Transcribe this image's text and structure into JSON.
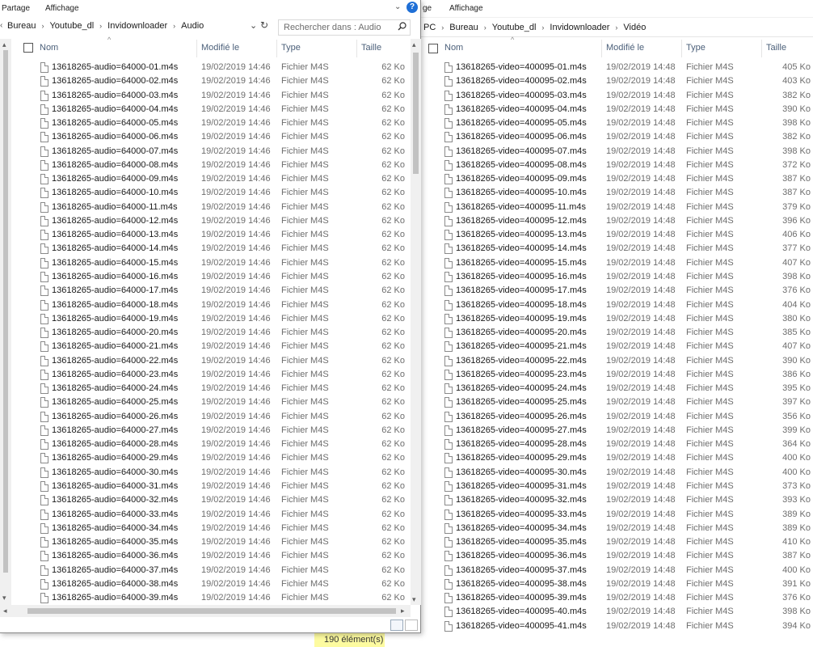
{
  "left_window": {
    "ribbon": {
      "share": "Partage",
      "view": "Affichage"
    },
    "breadcrumb": [
      "Bureau",
      "Youtube_dl",
      "Invidownloader",
      "Audio"
    ],
    "search_placeholder": "Rechercher dans : Audio",
    "columns": {
      "name": "Nom",
      "modified": "Modifié le",
      "type": "Type",
      "size": "Taille"
    },
    "files": [
      {
        "name": "13618265-audio=64000-01.m4s",
        "date": "19/02/2019 14:46",
        "type": "Fichier M4S",
        "size": "62 Ko"
      },
      {
        "name": "13618265-audio=64000-02.m4s",
        "date": "19/02/2019 14:46",
        "type": "Fichier M4S",
        "size": "62 Ko"
      },
      {
        "name": "13618265-audio=64000-03.m4s",
        "date": "19/02/2019 14:46",
        "type": "Fichier M4S",
        "size": "62 Ko"
      },
      {
        "name": "13618265-audio=64000-04.m4s",
        "date": "19/02/2019 14:46",
        "type": "Fichier M4S",
        "size": "62 Ko"
      },
      {
        "name": "13618265-audio=64000-05.m4s",
        "date": "19/02/2019 14:46",
        "type": "Fichier M4S",
        "size": "62 Ko"
      },
      {
        "name": "13618265-audio=64000-06.m4s",
        "date": "19/02/2019 14:46",
        "type": "Fichier M4S",
        "size": "62 Ko"
      },
      {
        "name": "13618265-audio=64000-07.m4s",
        "date": "19/02/2019 14:46",
        "type": "Fichier M4S",
        "size": "62 Ko"
      },
      {
        "name": "13618265-audio=64000-08.m4s",
        "date": "19/02/2019 14:46",
        "type": "Fichier M4S",
        "size": "62 Ko"
      },
      {
        "name": "13618265-audio=64000-09.m4s",
        "date": "19/02/2019 14:46",
        "type": "Fichier M4S",
        "size": "62 Ko"
      },
      {
        "name": "13618265-audio=64000-10.m4s",
        "date": "19/02/2019 14:46",
        "type": "Fichier M4S",
        "size": "62 Ko"
      },
      {
        "name": "13618265-audio=64000-11.m4s",
        "date": "19/02/2019 14:46",
        "type": "Fichier M4S",
        "size": "62 Ko"
      },
      {
        "name": "13618265-audio=64000-12.m4s",
        "date": "19/02/2019 14:46",
        "type": "Fichier M4S",
        "size": "62 Ko"
      },
      {
        "name": "13618265-audio=64000-13.m4s",
        "date": "19/02/2019 14:46",
        "type": "Fichier M4S",
        "size": "62 Ko"
      },
      {
        "name": "13618265-audio=64000-14.m4s",
        "date": "19/02/2019 14:46",
        "type": "Fichier M4S",
        "size": "62 Ko"
      },
      {
        "name": "13618265-audio=64000-15.m4s",
        "date": "19/02/2019 14:46",
        "type": "Fichier M4S",
        "size": "62 Ko"
      },
      {
        "name": "13618265-audio=64000-16.m4s",
        "date": "19/02/2019 14:46",
        "type": "Fichier M4S",
        "size": "62 Ko"
      },
      {
        "name": "13618265-audio=64000-17.m4s",
        "date": "19/02/2019 14:46",
        "type": "Fichier M4S",
        "size": "62 Ko"
      },
      {
        "name": "13618265-audio=64000-18.m4s",
        "date": "19/02/2019 14:46",
        "type": "Fichier M4S",
        "size": "62 Ko"
      },
      {
        "name": "13618265-audio=64000-19.m4s",
        "date": "19/02/2019 14:46",
        "type": "Fichier M4S",
        "size": "62 Ko"
      },
      {
        "name": "13618265-audio=64000-20.m4s",
        "date": "19/02/2019 14:46",
        "type": "Fichier M4S",
        "size": "62 Ko"
      },
      {
        "name": "13618265-audio=64000-21.m4s",
        "date": "19/02/2019 14:46",
        "type": "Fichier M4S",
        "size": "62 Ko"
      },
      {
        "name": "13618265-audio=64000-22.m4s",
        "date": "19/02/2019 14:46",
        "type": "Fichier M4S",
        "size": "62 Ko"
      },
      {
        "name": "13618265-audio=64000-23.m4s",
        "date": "19/02/2019 14:46",
        "type": "Fichier M4S",
        "size": "62 Ko"
      },
      {
        "name": "13618265-audio=64000-24.m4s",
        "date": "19/02/2019 14:46",
        "type": "Fichier M4S",
        "size": "62 Ko"
      },
      {
        "name": "13618265-audio=64000-25.m4s",
        "date": "19/02/2019 14:46",
        "type": "Fichier M4S",
        "size": "62 Ko"
      },
      {
        "name": "13618265-audio=64000-26.m4s",
        "date": "19/02/2019 14:46",
        "type": "Fichier M4S",
        "size": "62 Ko"
      },
      {
        "name": "13618265-audio=64000-27.m4s",
        "date": "19/02/2019 14:46",
        "type": "Fichier M4S",
        "size": "62 Ko"
      },
      {
        "name": "13618265-audio=64000-28.m4s",
        "date": "19/02/2019 14:46",
        "type": "Fichier M4S",
        "size": "62 Ko"
      },
      {
        "name": "13618265-audio=64000-29.m4s",
        "date": "19/02/2019 14:46",
        "type": "Fichier M4S",
        "size": "62 Ko"
      },
      {
        "name": "13618265-audio=64000-30.m4s",
        "date": "19/02/2019 14:46",
        "type": "Fichier M4S",
        "size": "62 Ko"
      },
      {
        "name": "13618265-audio=64000-31.m4s",
        "date": "19/02/2019 14:46",
        "type": "Fichier M4S",
        "size": "62 Ko"
      },
      {
        "name": "13618265-audio=64000-32.m4s",
        "date": "19/02/2019 14:46",
        "type": "Fichier M4S",
        "size": "62 Ko"
      },
      {
        "name": "13618265-audio=64000-33.m4s",
        "date": "19/02/2019 14:46",
        "type": "Fichier M4S",
        "size": "62 Ko"
      },
      {
        "name": "13618265-audio=64000-34.m4s",
        "date": "19/02/2019 14:46",
        "type": "Fichier M4S",
        "size": "62 Ko"
      },
      {
        "name": "13618265-audio=64000-35.m4s",
        "date": "19/02/2019 14:46",
        "type": "Fichier M4S",
        "size": "62 Ko"
      },
      {
        "name": "13618265-audio=64000-36.m4s",
        "date": "19/02/2019 14:46",
        "type": "Fichier M4S",
        "size": "62 Ko"
      },
      {
        "name": "13618265-audio=64000-37.m4s",
        "date": "19/02/2019 14:46",
        "type": "Fichier M4S",
        "size": "62 Ko"
      },
      {
        "name": "13618265-audio=64000-38.m4s",
        "date": "19/02/2019 14:46",
        "type": "Fichier M4S",
        "size": "62 Ko"
      },
      {
        "name": "13618265-audio=64000-39.m4s",
        "date": "19/02/2019 14:46",
        "type": "Fichier M4S",
        "size": "62 Ko"
      }
    ]
  },
  "right_window": {
    "ribbon": {
      "share_partial": "ge",
      "view": "Affichage"
    },
    "breadcrumb": [
      "PC",
      "Bureau",
      "Youtube_dl",
      "Invidownloader",
      "Vidéo"
    ],
    "columns": {
      "name": "Nom",
      "modified": "Modifié le",
      "type": "Type",
      "size": "Taille"
    },
    "files": [
      {
        "name": "13618265-video=400095-01.m4s",
        "date": "19/02/2019 14:48",
        "type": "Fichier M4S",
        "size": "405 Ko"
      },
      {
        "name": "13618265-video=400095-02.m4s",
        "date": "19/02/2019 14:48",
        "type": "Fichier M4S",
        "size": "403 Ko"
      },
      {
        "name": "13618265-video=400095-03.m4s",
        "date": "19/02/2019 14:48",
        "type": "Fichier M4S",
        "size": "382 Ko"
      },
      {
        "name": "13618265-video=400095-04.m4s",
        "date": "19/02/2019 14:48",
        "type": "Fichier M4S",
        "size": "390 Ko"
      },
      {
        "name": "13618265-video=400095-05.m4s",
        "date": "19/02/2019 14:48",
        "type": "Fichier M4S",
        "size": "398 Ko"
      },
      {
        "name": "13618265-video=400095-06.m4s",
        "date": "19/02/2019 14:48",
        "type": "Fichier M4S",
        "size": "382 Ko"
      },
      {
        "name": "13618265-video=400095-07.m4s",
        "date": "19/02/2019 14:48",
        "type": "Fichier M4S",
        "size": "398 Ko"
      },
      {
        "name": "13618265-video=400095-08.m4s",
        "date": "19/02/2019 14:48",
        "type": "Fichier M4S",
        "size": "372 Ko"
      },
      {
        "name": "13618265-video=400095-09.m4s",
        "date": "19/02/2019 14:48",
        "type": "Fichier M4S",
        "size": "387 Ko"
      },
      {
        "name": "13618265-video=400095-10.m4s",
        "date": "19/02/2019 14:48",
        "type": "Fichier M4S",
        "size": "387 Ko"
      },
      {
        "name": "13618265-video=400095-11.m4s",
        "date": "19/02/2019 14:48",
        "type": "Fichier M4S",
        "size": "379 Ko"
      },
      {
        "name": "13618265-video=400095-12.m4s",
        "date": "19/02/2019 14:48",
        "type": "Fichier M4S",
        "size": "396 Ko"
      },
      {
        "name": "13618265-video=400095-13.m4s",
        "date": "19/02/2019 14:48",
        "type": "Fichier M4S",
        "size": "406 Ko"
      },
      {
        "name": "13618265-video=400095-14.m4s",
        "date": "19/02/2019 14:48",
        "type": "Fichier M4S",
        "size": "377 Ko"
      },
      {
        "name": "13618265-video=400095-15.m4s",
        "date": "19/02/2019 14:48",
        "type": "Fichier M4S",
        "size": "407 Ko"
      },
      {
        "name": "13618265-video=400095-16.m4s",
        "date": "19/02/2019 14:48",
        "type": "Fichier M4S",
        "size": "398 Ko"
      },
      {
        "name": "13618265-video=400095-17.m4s",
        "date": "19/02/2019 14:48",
        "type": "Fichier M4S",
        "size": "376 Ko"
      },
      {
        "name": "13618265-video=400095-18.m4s",
        "date": "19/02/2019 14:48",
        "type": "Fichier M4S",
        "size": "404 Ko"
      },
      {
        "name": "13618265-video=400095-19.m4s",
        "date": "19/02/2019 14:48",
        "type": "Fichier M4S",
        "size": "380 Ko"
      },
      {
        "name": "13618265-video=400095-20.m4s",
        "date": "19/02/2019 14:48",
        "type": "Fichier M4S",
        "size": "385 Ko"
      },
      {
        "name": "13618265-video=400095-21.m4s",
        "date": "19/02/2019 14:48",
        "type": "Fichier M4S",
        "size": "407 Ko"
      },
      {
        "name": "13618265-video=400095-22.m4s",
        "date": "19/02/2019 14:48",
        "type": "Fichier M4S",
        "size": "390 Ko"
      },
      {
        "name": "13618265-video=400095-23.m4s",
        "date": "19/02/2019 14:48",
        "type": "Fichier M4S",
        "size": "386 Ko"
      },
      {
        "name": "13618265-video=400095-24.m4s",
        "date": "19/02/2019 14:48",
        "type": "Fichier M4S",
        "size": "395 Ko"
      },
      {
        "name": "13618265-video=400095-25.m4s",
        "date": "19/02/2019 14:48",
        "type": "Fichier M4S",
        "size": "397 Ko"
      },
      {
        "name": "13618265-video=400095-26.m4s",
        "date": "19/02/2019 14:48",
        "type": "Fichier M4S",
        "size": "356 Ko"
      },
      {
        "name": "13618265-video=400095-27.m4s",
        "date": "19/02/2019 14:48",
        "type": "Fichier M4S",
        "size": "399 Ko"
      },
      {
        "name": "13618265-video=400095-28.m4s",
        "date": "19/02/2019 14:48",
        "type": "Fichier M4S",
        "size": "364 Ko"
      },
      {
        "name": "13618265-video=400095-29.m4s",
        "date": "19/02/2019 14:48",
        "type": "Fichier M4S",
        "size": "400 Ko"
      },
      {
        "name": "13618265-video=400095-30.m4s",
        "date": "19/02/2019 14:48",
        "type": "Fichier M4S",
        "size": "400 Ko"
      },
      {
        "name": "13618265-video=400095-31.m4s",
        "date": "19/02/2019 14:48",
        "type": "Fichier M4S",
        "size": "373 Ko"
      },
      {
        "name": "13618265-video=400095-32.m4s",
        "date": "19/02/2019 14:48",
        "type": "Fichier M4S",
        "size": "393 Ko"
      },
      {
        "name": "13618265-video=400095-33.m4s",
        "date": "19/02/2019 14:48",
        "type": "Fichier M4S",
        "size": "389 Ko"
      },
      {
        "name": "13618265-video=400095-34.m4s",
        "date": "19/02/2019 14:48",
        "type": "Fichier M4S",
        "size": "389 Ko"
      },
      {
        "name": "13618265-video=400095-35.m4s",
        "date": "19/02/2019 14:48",
        "type": "Fichier M4S",
        "size": "410 Ko"
      },
      {
        "name": "13618265-video=400095-36.m4s",
        "date": "19/02/2019 14:48",
        "type": "Fichier M4S",
        "size": "387 Ko"
      },
      {
        "name": "13618265-video=400095-37.m4s",
        "date": "19/02/2019 14:48",
        "type": "Fichier M4S",
        "size": "400 Ko"
      },
      {
        "name": "13618265-video=400095-38.m4s",
        "date": "19/02/2019 14:48",
        "type": "Fichier M4S",
        "size": "391 Ko"
      },
      {
        "name": "13618265-video=400095-39.m4s",
        "date": "19/02/2019 14:48",
        "type": "Fichier M4S",
        "size": "376 Ko"
      },
      {
        "name": "13618265-video=400095-40.m4s",
        "date": "19/02/2019 14:48",
        "type": "Fichier M4S",
        "size": "398 Ko"
      },
      {
        "name": "13618265-video=400095-41.m4s",
        "date": "19/02/2019 14:48",
        "type": "Fichier M4S",
        "size": "394 Ko"
      }
    ]
  },
  "status": {
    "item_count": "190 élément(s)"
  },
  "colors": {
    "header_text": "#4c607a",
    "secondary_text": "#6d6d6d",
    "status_highlight": "#fdfba0"
  }
}
